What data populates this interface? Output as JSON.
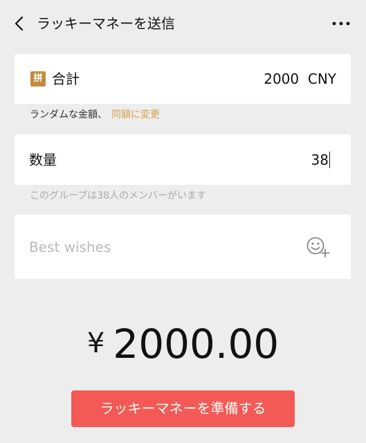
{
  "header": {
    "title": "ラッキーマネーを送信",
    "back_icon": "chevron-left-icon",
    "more_icon": "more-horizontal-icon"
  },
  "total": {
    "badge": "拼",
    "label": "合計",
    "value": "2000  CNY"
  },
  "random_hint": {
    "text": "ランダムな金額、",
    "link": "同額に変更",
    "link_color": "#d4a04a"
  },
  "quantity": {
    "label": "数量",
    "value": "38"
  },
  "group_hint": "このグループは38人のメンバーがいます",
  "message": {
    "placeholder": "Best wishes",
    "emoji_icon": "emoji-add-icon"
  },
  "amount": {
    "currency": "¥",
    "value": "2000.00"
  },
  "prepare_button": {
    "label": "ラッキーマネーを準備する",
    "color": "#f35a55"
  }
}
